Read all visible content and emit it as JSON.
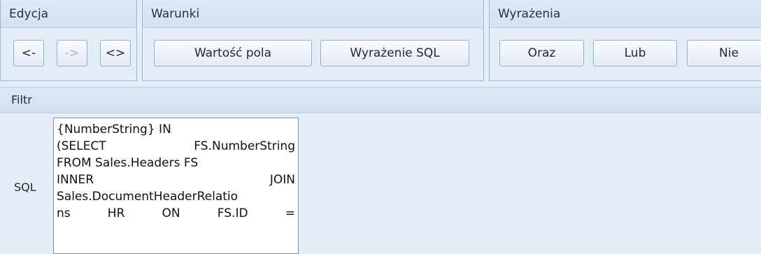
{
  "ribbon": {
    "edycja": {
      "title": "Edycja",
      "buttons": [
        "<-",
        "->",
        "<>"
      ]
    },
    "warunki": {
      "title": "Warunki",
      "buttons": [
        "Wartość pola",
        "Wyrażenie SQL"
      ]
    },
    "wyrazenia": {
      "title": "Wyrażenia",
      "buttons": [
        "Oraz",
        "Lub",
        "Nie"
      ]
    }
  },
  "filter": {
    "title": "Filtr",
    "sql_label": "SQL",
    "sql_lines": [
      [
        "{NumberString} IN"
      ],
      [
        "(SELECT",
        "FS.NumberString"
      ],
      [
        "FROM Sales.Headers FS"
      ],
      [
        "INNER",
        "JOIN"
      ],
      [
        "Sales.DocumentHeaderRelatio"
      ],
      [
        "ns",
        "HR",
        "ON",
        "FS.ID",
        "="
      ]
    ]
  }
}
